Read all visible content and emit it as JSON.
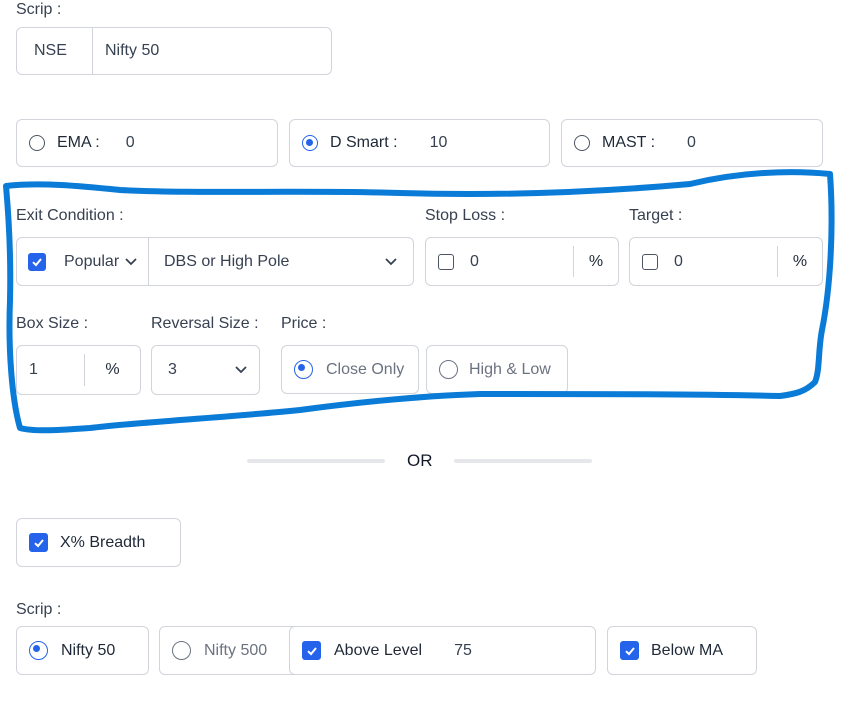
{
  "scrip_top": {
    "label": "Scrip :",
    "exchange": "NSE",
    "symbol": "Nifty 50"
  },
  "indicators": [
    {
      "label": "EMA :",
      "value": "0",
      "selected": false
    },
    {
      "label": "D Smart :",
      "value": "10",
      "selected": true
    },
    {
      "label": "MAST :",
      "value": "0",
      "selected": false
    }
  ],
  "exit": {
    "label": "Exit Condition :",
    "enabled": true,
    "type_value": "Popular",
    "condition_value": "DBS or High Pole"
  },
  "stop_loss": {
    "label": "Stop Loss :",
    "value": "0",
    "unit": "%",
    "enabled": false
  },
  "target": {
    "label": "Target :",
    "value": "0",
    "unit": "%",
    "enabled": false
  },
  "box_size": {
    "label": "Box Size :",
    "value": "1",
    "unit": "%"
  },
  "reversal": {
    "label": "Reversal Size :",
    "value": "3"
  },
  "price": {
    "label": "Price :",
    "options": [
      {
        "label": "Close Only",
        "selected": true
      },
      {
        "label": "High & Low",
        "selected": false
      }
    ]
  },
  "or_text": "OR",
  "breadth": {
    "label": "X% Breadth",
    "checked": true
  },
  "scrip_bottom": {
    "label": "Scrip :",
    "options": [
      {
        "label": "Nifty 50",
        "selected": true
      },
      {
        "label": "Nifty 500",
        "selected": false
      }
    ],
    "above_level": {
      "label": "Above Level",
      "value": "75",
      "checked": true
    },
    "below_ma": {
      "label": "Below MA",
      "checked": true
    }
  },
  "colors": {
    "accent": "#2563eb",
    "annotation": "#0a7bd6",
    "border": "#d1d5db"
  }
}
